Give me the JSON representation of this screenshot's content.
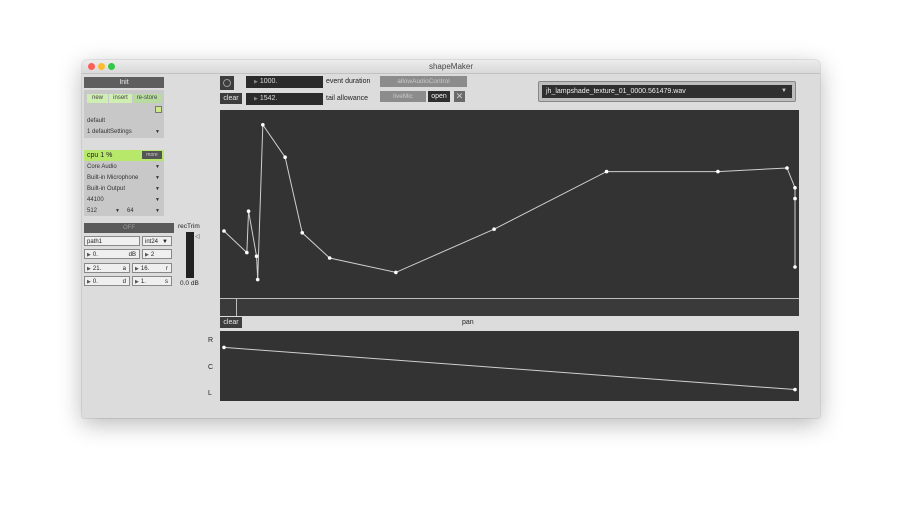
{
  "window": {
    "title": "shapeMaker"
  },
  "left_panel": {
    "init_label": "Init",
    "preset_buttons": [
      "new",
      "insert",
      "re-store"
    ],
    "preset_menu": "default",
    "settings_menu": "1 defaultSettings",
    "cpu_label": "cpu 1 %",
    "more_label": "more",
    "audio_menus": [
      "Core Audio",
      "Built-in Microphone",
      "Built-in Output",
      "44100"
    ],
    "buffer_left": "512",
    "buffer_right": "64",
    "off_label": "OFF",
    "path_label": "path1",
    "format_label": "int24",
    "rectrim_label": "recTrim",
    "rectrim_value": "0.0 dB",
    "numbers": [
      {
        "value": "0.",
        "unit": "dB"
      },
      {
        "value": "2",
        "unit": ""
      },
      {
        "value": "21.",
        "unit": "a"
      },
      {
        "value": "16.",
        "unit": "r"
      },
      {
        "value": "0.",
        "unit": "d"
      },
      {
        "value": "1.",
        "unit": "s"
      }
    ]
  },
  "top_controls": {
    "clear_label": "clear",
    "event_duration_value": "1000.",
    "event_duration_label": "event duration",
    "tail_value": "1542.",
    "tail_label": "tail allowance",
    "allow_audio_label": "allowAudioControl",
    "live_mic_label": "liveMic",
    "open_label": "open",
    "close_glyph": "✕",
    "file_menu": "jh_lampshade_texture_01_0000.561479.wav"
  },
  "pan": {
    "clear_label": "clear",
    "title": "pan",
    "r_label": "R",
    "c_label": "C",
    "l_label": "L"
  },
  "colors": {
    "editor_bg": "#333333",
    "line": "#d0d0d0",
    "point": "#ffffff"
  },
  "chart_data": [
    {
      "type": "line",
      "title": "",
      "xlabel": "",
      "ylabel": "",
      "xlim": [
        0,
        1
      ],
      "ylim": [
        0,
        1
      ],
      "grid": false,
      "series": [
        {
          "x": [
            0.0,
            0.04,
            0.043,
            0.057,
            0.059,
            0.068,
            0.107,
            0.137,
            0.185,
            0.301,
            0.473,
            0.67,
            0.865,
            0.986,
            1.035,
            1.066,
            1.085
          ],
          "y": [
            0.35,
            0.23,
            0.46,
            0.21,
            0.08,
            0.94,
            0.76,
            0.34,
            0.2,
            0.12,
            0.36,
            0.68,
            0.68,
            0.7,
            0.59,
            0.15,
            0.53
          ]
        }
      ]
    },
    {
      "type": "line",
      "title": "pan",
      "xlabel": "",
      "ylabel": "",
      "xlim": [
        0,
        1
      ],
      "ylim": [
        0,
        1
      ],
      "y_ticks": [
        "L",
        "C",
        "R"
      ],
      "grid": false,
      "series": [
        {
          "x": [
            0.0,
            1.0
          ],
          "y": [
            0.8,
            0.12
          ]
        }
      ]
    }
  ]
}
